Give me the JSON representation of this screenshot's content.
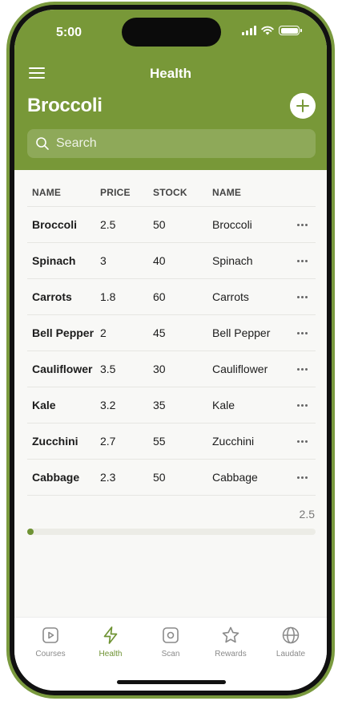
{
  "status_bar": {
    "time": "5:00"
  },
  "header": {
    "nav_title": "Health",
    "page_title": "Broccoli"
  },
  "search": {
    "placeholder": "Search"
  },
  "table": {
    "columns": [
      "NAME",
      "PRICE",
      "STOCK",
      "NAME"
    ],
    "rows": [
      [
        "Broccoli",
        "2.5",
        "50",
        "Broccoli"
      ],
      [
        "Spinach",
        "3",
        "40",
        "Spinach"
      ],
      [
        "Carrots",
        "1.8",
        "60",
        "Carrots"
      ],
      [
        "Bell Pepper",
        "2",
        "45",
        "Bell Pepper"
      ],
      [
        "Cauliflower",
        "3.5",
        "30",
        "Cauliflower"
      ],
      [
        "Kale",
        "3.2",
        "35",
        "Kale"
      ],
      [
        "Zucchini",
        "2.7",
        "55",
        "Zucchini"
      ],
      [
        "Cabbage",
        "2.3",
        "50",
        "Cabbage"
      ]
    ]
  },
  "scrubber": {
    "value_label": "2.5",
    "level": 0.0
  },
  "tabbar": {
    "tabs": [
      {
        "label": "Courses",
        "icon": "play-icon",
        "active": false
      },
      {
        "label": "Health",
        "icon": "bolt-icon",
        "active": true
      },
      {
        "label": "Scan",
        "icon": "scan-icon",
        "active": false
      },
      {
        "label": "Rewards",
        "icon": "star-icon",
        "active": false
      },
      {
        "label": "Laudate",
        "icon": "globe-icon",
        "active": false
      }
    ]
  },
  "colors": {
    "accent": "#789838",
    "active_tab": "#6f9334"
  }
}
